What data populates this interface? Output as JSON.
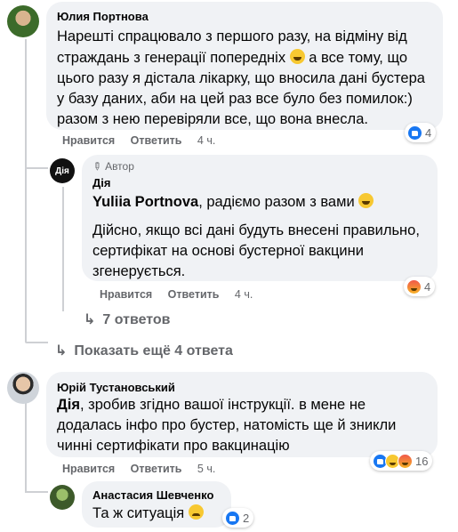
{
  "comments": [
    {
      "author": "Юлия Портнова",
      "lines": [
        "Нарешті спрацювало з першого разу, на відміну від",
        "страждань з генерації попередніх",
        "а все тому, що",
        "цього разу я дістала лікарку, що вносила дані бустера",
        "у базу даних, аби на цей раз все було без помилок:)",
        "разом з нею перевіряли все, що вона внесла."
      ],
      "like_label": "Нравится",
      "reply_label": "Ответить",
      "time": "4 ч.",
      "reaction_count": "4"
    },
    {
      "badge": "Автор",
      "author": "Дія",
      "mention": "Yuliia Portnova",
      "mention_rest": ", радіємо разом з вами",
      "lines": [
        "Дійсно, якщо всі дані будуть внесені правильно,",
        "сертифікат на основі бустерної вакцини",
        "згенерується."
      ],
      "like_label": "Нравится",
      "reply_label": "Ответить",
      "time": "4 ч.",
      "reaction_count": "4"
    },
    {
      "author": "Юрій Тустановський",
      "mention": "Дія",
      "lines": [
        ", зробив згідно вашої інструкції. в мене не",
        "додалась інфо про бустер, натомість ще й зникли",
        "чинні сертифікати про вакцинацію"
      ],
      "like_label": "Нравится",
      "reply_label": "Ответить",
      "time": "5 ч.",
      "reaction_count": "16"
    },
    {
      "author": "Анастасия Шевченко",
      "lines": [
        "Та ж ситуація"
      ],
      "reaction_count": "2"
    }
  ],
  "links": {
    "replies_7": "7 ответов",
    "show_more": "Показать ещё 4 ответа"
  },
  "colors": {
    "bubble": "#f0f2f5",
    "link_gray": "#65676b",
    "like_blue": "#1877f2"
  }
}
